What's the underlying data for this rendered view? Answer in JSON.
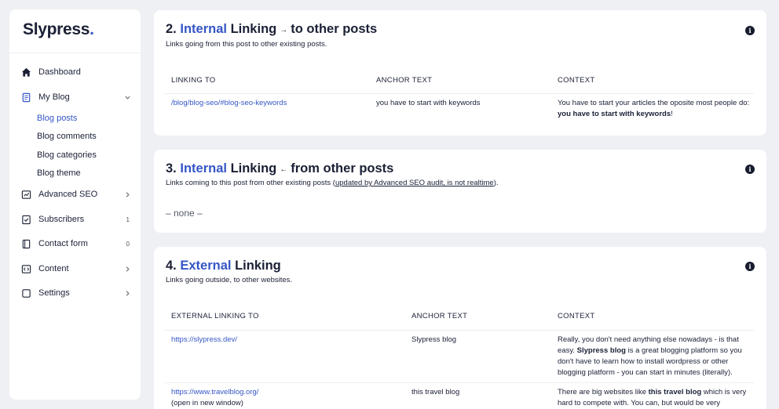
{
  "brand": {
    "name": "Slypress",
    "dot": "."
  },
  "sidebar": {
    "items": [
      {
        "label": "Dashboard",
        "icon": "home-icon"
      },
      {
        "label": "My Blog",
        "icon": "document-icon",
        "expanded": true,
        "children": [
          "Blog posts",
          "Blog comments",
          "Blog categories",
          "Blog theme"
        ],
        "active_child": "Blog posts"
      },
      {
        "label": "Advanced SEO",
        "icon": "seo-icon"
      },
      {
        "label": "Subscribers",
        "icon": "checkbox-icon",
        "count": "1"
      },
      {
        "label": "Contact form",
        "icon": "book-icon",
        "count": "0"
      },
      {
        "label": "Content",
        "icon": "code-icon"
      },
      {
        "label": "Settings",
        "icon": "settings-icon"
      }
    ]
  },
  "internal_to": {
    "num": "2.",
    "hl": "Internal",
    "word": "Linking",
    "arrow": "→",
    "rest": "to other posts",
    "subtitle": "Links going from this post to other existing posts.",
    "headers": [
      "LINKING TO",
      "ANCHOR TEXT",
      "CONTEXT"
    ],
    "rows": [
      {
        "link": "/blog/blog-seo/#blog-seo-keywords",
        "anchor": "you have to start with keywords",
        "context_pre": "You have to start your articles the oposite most people do: ",
        "context_bold": "you have to start with keywords",
        "context_post": "!"
      }
    ]
  },
  "internal_from": {
    "num": "3.",
    "hl": "Internal",
    "word": "Linking",
    "arrow": "←",
    "rest": "from other posts",
    "subtitle_pre": "Links coming to this post from other existing posts (",
    "subtitle_link": "updated by Advanced SEO audit, is not realtime",
    "subtitle_post": ").",
    "empty": "– none –"
  },
  "external": {
    "num": "4.",
    "hl": "External",
    "word": "Linking",
    "subtitle": "Links going outside, to other websites.",
    "headers": [
      "EXTERNAL LINKING TO",
      "ANCHOR TEXT",
      "CONTEXT"
    ],
    "rows": [
      {
        "link": "https://slypress.dev/",
        "note": "",
        "anchor": "Slypress blog",
        "context_pre": "Really, you don't need anything else nowadays - is that easy. ",
        "context_bold": "Slypress blog",
        "context_post": " is a great blogging platform so you don't have to learn how to install wordpress or other blogging platform - you can start in minutes (literally)."
      },
      {
        "link": "https://www.travelblog.org/",
        "note": "(open in new window)",
        "anchor": "this travel blog",
        "context_pre": "There are big websites like ",
        "context_bold": "this travel blog",
        "context_post": " which is very hard to compete with. You can, but would be very"
      }
    ]
  },
  "colors": {
    "accent": "#3556c6",
    "text": "#1b2036",
    "background": "#eef0f4"
  }
}
